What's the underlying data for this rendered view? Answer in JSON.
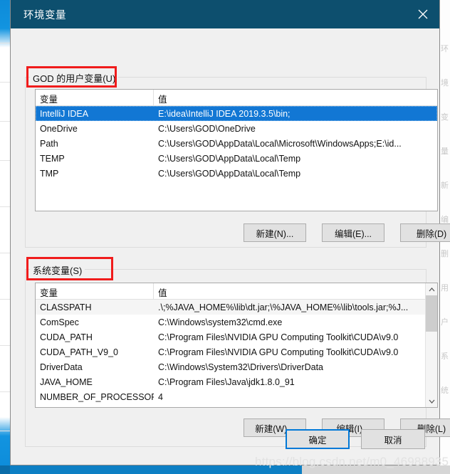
{
  "window": {
    "title": "环境变量",
    "close_icon": "close-icon"
  },
  "user_section": {
    "label": "GOD 的用户变量(U)",
    "columns": [
      "变量",
      "值"
    ],
    "rows": [
      {
        "name": "IntelliJ IDEA",
        "value": "E:\\idea\\IntelliJ IDEA 2019.3.5\\bin;",
        "selected": true
      },
      {
        "name": "OneDrive",
        "value": "C:\\Users\\GOD\\OneDrive",
        "selected": false
      },
      {
        "name": "Path",
        "value": "C:\\Users\\GOD\\AppData\\Local\\Microsoft\\WindowsApps;E:\\id...",
        "selected": false
      },
      {
        "name": "TEMP",
        "value": "C:\\Users\\GOD\\AppData\\Local\\Temp",
        "selected": false
      },
      {
        "name": "TMP",
        "value": "C:\\Users\\GOD\\AppData\\Local\\Temp",
        "selected": false
      }
    ],
    "buttons": {
      "new": "新建(N)...",
      "edit": "编辑(E)...",
      "delete": "删除(D)"
    }
  },
  "system_section": {
    "label": "系统变量(S)",
    "columns": [
      "变量",
      "值"
    ],
    "rows": [
      {
        "name": "CLASSPATH",
        "value": ".\\;%JAVA_HOME%\\lib\\dt.jar;\\%JAVA_HOME%\\lib\\tools.jar;%J...",
        "alt": true
      },
      {
        "name": "ComSpec",
        "value": "C:\\Windows\\system32\\cmd.exe",
        "alt": false
      },
      {
        "name": "CUDA_PATH",
        "value": "C:\\Program Files\\NVIDIA GPU Computing Toolkit\\CUDA\\v9.0",
        "alt": false
      },
      {
        "name": "CUDA_PATH_V9_0",
        "value": "C:\\Program Files\\NVIDIA GPU Computing Toolkit\\CUDA\\v9.0",
        "alt": false
      },
      {
        "name": "DriverData",
        "value": "C:\\Windows\\System32\\Drivers\\DriverData",
        "alt": false
      },
      {
        "name": "JAVA_HOME",
        "value": "C:\\Program Files\\Java\\jdk1.8.0_91",
        "alt": false
      },
      {
        "name": "NUMBER_OF_PROCESSORS",
        "value": "4",
        "alt": false
      }
    ],
    "buttons": {
      "new": "新建(W)...",
      "edit": "编辑(I)...",
      "delete": "删除(L)"
    },
    "scrollbar": {
      "up_icon": "chevron-up-icon",
      "down_icon": "chevron-down-icon"
    }
  },
  "footer": {
    "ok": "确定",
    "cancel": "取消"
  },
  "watermark": "https://blog.csdn.net/m0_46988935",
  "colors": {
    "titlebar": "#0d4f6e",
    "selection": "#1277d4",
    "annotation": "#f01c1c",
    "dialog_bg": "#f0f0f0",
    "accent": "#0078d7"
  },
  "backdrop": {
    "right_fragments": [
      "环",
      "境",
      "变",
      "量",
      "新",
      "编",
      "删",
      "用",
      "户",
      "系",
      "统"
    ]
  }
}
